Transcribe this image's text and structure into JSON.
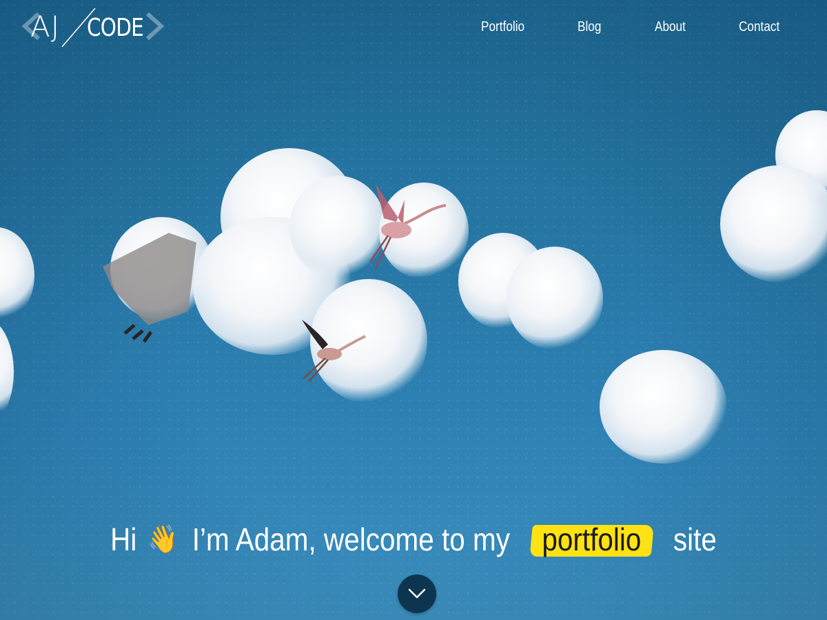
{
  "header": {
    "logo_left": "AJ",
    "logo_right": "CODE",
    "nav": [
      "Portfolio",
      "Blog",
      "About",
      "Contact"
    ]
  },
  "hero": {
    "greeting": "Hi",
    "wave_emoji": "👋",
    "intro": "I’m Adam, welcome to my",
    "highlight": "portfolio",
    "suffix": "site",
    "scroll_icon": "chevron-down-icon"
  },
  "colors": {
    "sky": "#2675a3",
    "highlight": "#ffe213",
    "scroll_button": "#0d3550",
    "text": "#ffffff"
  }
}
